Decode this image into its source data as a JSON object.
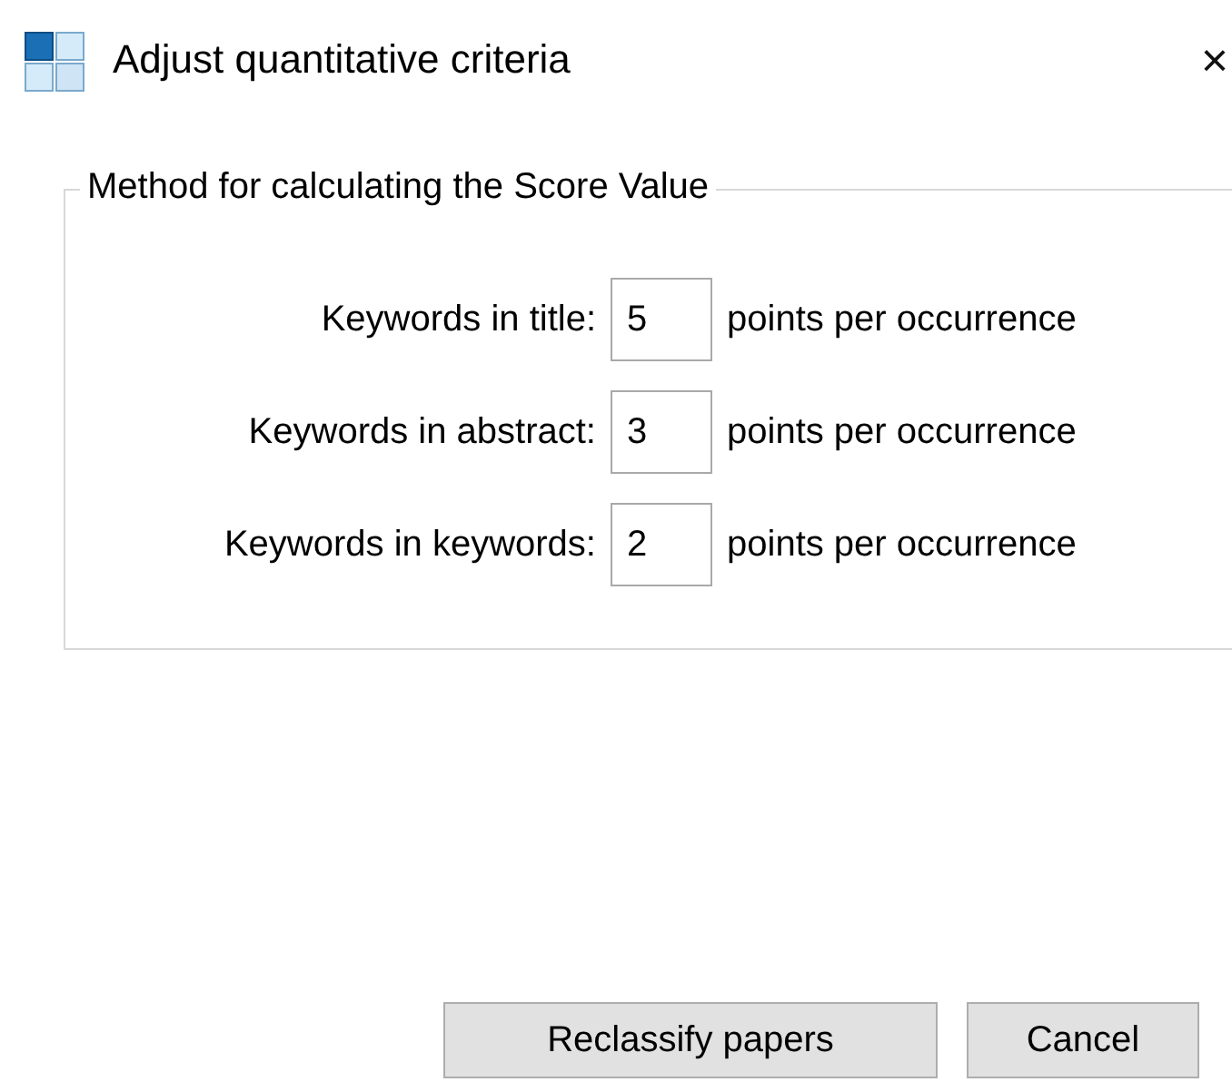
{
  "window": {
    "title": "Adjust quantitative criteria",
    "close": "×"
  },
  "group": {
    "legend": "Method for calculating the Score Value",
    "rows": [
      {
        "label": "Keywords in title:",
        "value": "5",
        "unit": "points per occurrence"
      },
      {
        "label": "Keywords in abstract:",
        "value": "3",
        "unit": "points per occurrence"
      },
      {
        "label": "Keywords in keywords:",
        "value": "2",
        "unit": "points per occurrence"
      }
    ]
  },
  "buttons": [
    "Reclassify papers",
    "Cancel"
  ]
}
